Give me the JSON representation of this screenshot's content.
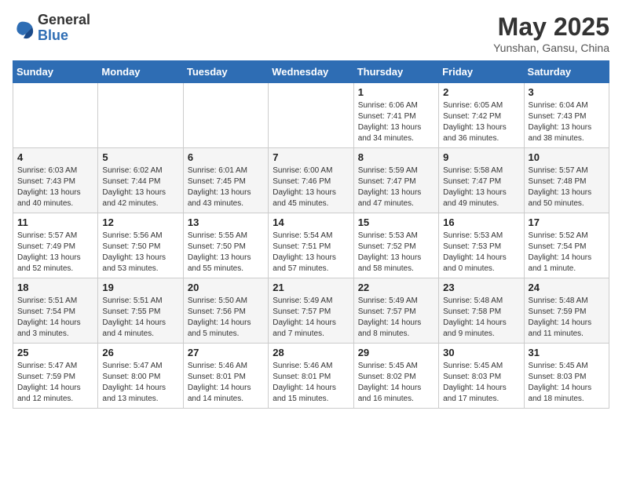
{
  "header": {
    "logo": {
      "general": "General",
      "blue": "Blue"
    },
    "title": "May 2025",
    "location": "Yunshan, Gansu, China"
  },
  "days_of_week": [
    "Sunday",
    "Monday",
    "Tuesday",
    "Wednesday",
    "Thursday",
    "Friday",
    "Saturday"
  ],
  "weeks": [
    [
      null,
      null,
      null,
      null,
      {
        "day": "1",
        "sunrise": "6:06 AM",
        "sunset": "7:41 PM",
        "daylight": "13 hours and 34 minutes."
      },
      {
        "day": "2",
        "sunrise": "6:05 AM",
        "sunset": "7:42 PM",
        "daylight": "13 hours and 36 minutes."
      },
      {
        "day": "3",
        "sunrise": "6:04 AM",
        "sunset": "7:43 PM",
        "daylight": "13 hours and 38 minutes."
      }
    ],
    [
      {
        "day": "4",
        "sunrise": "6:03 AM",
        "sunset": "7:43 PM",
        "daylight": "13 hours and 40 minutes."
      },
      {
        "day": "5",
        "sunrise": "6:02 AM",
        "sunset": "7:44 PM",
        "daylight": "13 hours and 42 minutes."
      },
      {
        "day": "6",
        "sunrise": "6:01 AM",
        "sunset": "7:45 PM",
        "daylight": "13 hours and 43 minutes."
      },
      {
        "day": "7",
        "sunrise": "6:00 AM",
        "sunset": "7:46 PM",
        "daylight": "13 hours and 45 minutes."
      },
      {
        "day": "8",
        "sunrise": "5:59 AM",
        "sunset": "7:47 PM",
        "daylight": "13 hours and 47 minutes."
      },
      {
        "day": "9",
        "sunrise": "5:58 AM",
        "sunset": "7:47 PM",
        "daylight": "13 hours and 49 minutes."
      },
      {
        "day": "10",
        "sunrise": "5:57 AM",
        "sunset": "7:48 PM",
        "daylight": "13 hours and 50 minutes."
      }
    ],
    [
      {
        "day": "11",
        "sunrise": "5:57 AM",
        "sunset": "7:49 PM",
        "daylight": "13 hours and 52 minutes."
      },
      {
        "day": "12",
        "sunrise": "5:56 AM",
        "sunset": "7:50 PM",
        "daylight": "13 hours and 53 minutes."
      },
      {
        "day": "13",
        "sunrise": "5:55 AM",
        "sunset": "7:50 PM",
        "daylight": "13 hours and 55 minutes."
      },
      {
        "day": "14",
        "sunrise": "5:54 AM",
        "sunset": "7:51 PM",
        "daylight": "13 hours and 57 minutes."
      },
      {
        "day": "15",
        "sunrise": "5:53 AM",
        "sunset": "7:52 PM",
        "daylight": "13 hours and 58 minutes."
      },
      {
        "day": "16",
        "sunrise": "5:53 AM",
        "sunset": "7:53 PM",
        "daylight": "14 hours and 0 minutes."
      },
      {
        "day": "17",
        "sunrise": "5:52 AM",
        "sunset": "7:54 PM",
        "daylight": "14 hours and 1 minute."
      }
    ],
    [
      {
        "day": "18",
        "sunrise": "5:51 AM",
        "sunset": "7:54 PM",
        "daylight": "14 hours and 3 minutes."
      },
      {
        "day": "19",
        "sunrise": "5:51 AM",
        "sunset": "7:55 PM",
        "daylight": "14 hours and 4 minutes."
      },
      {
        "day": "20",
        "sunrise": "5:50 AM",
        "sunset": "7:56 PM",
        "daylight": "14 hours and 5 minutes."
      },
      {
        "day": "21",
        "sunrise": "5:49 AM",
        "sunset": "7:57 PM",
        "daylight": "14 hours and 7 minutes."
      },
      {
        "day": "22",
        "sunrise": "5:49 AM",
        "sunset": "7:57 PM",
        "daylight": "14 hours and 8 minutes."
      },
      {
        "day": "23",
        "sunrise": "5:48 AM",
        "sunset": "7:58 PM",
        "daylight": "14 hours and 9 minutes."
      },
      {
        "day": "24",
        "sunrise": "5:48 AM",
        "sunset": "7:59 PM",
        "daylight": "14 hours and 11 minutes."
      }
    ],
    [
      {
        "day": "25",
        "sunrise": "5:47 AM",
        "sunset": "7:59 PM",
        "daylight": "14 hours and 12 minutes."
      },
      {
        "day": "26",
        "sunrise": "5:47 AM",
        "sunset": "8:00 PM",
        "daylight": "14 hours and 13 minutes."
      },
      {
        "day": "27",
        "sunrise": "5:46 AM",
        "sunset": "8:01 PM",
        "daylight": "14 hours and 14 minutes."
      },
      {
        "day": "28",
        "sunrise": "5:46 AM",
        "sunset": "8:01 PM",
        "daylight": "14 hours and 15 minutes."
      },
      {
        "day": "29",
        "sunrise": "5:45 AM",
        "sunset": "8:02 PM",
        "daylight": "14 hours and 16 minutes."
      },
      {
        "day": "30",
        "sunrise": "5:45 AM",
        "sunset": "8:03 PM",
        "daylight": "14 hours and 17 minutes."
      },
      {
        "day": "31",
        "sunrise": "5:45 AM",
        "sunset": "8:03 PM",
        "daylight": "14 hours and 18 minutes."
      }
    ]
  ]
}
